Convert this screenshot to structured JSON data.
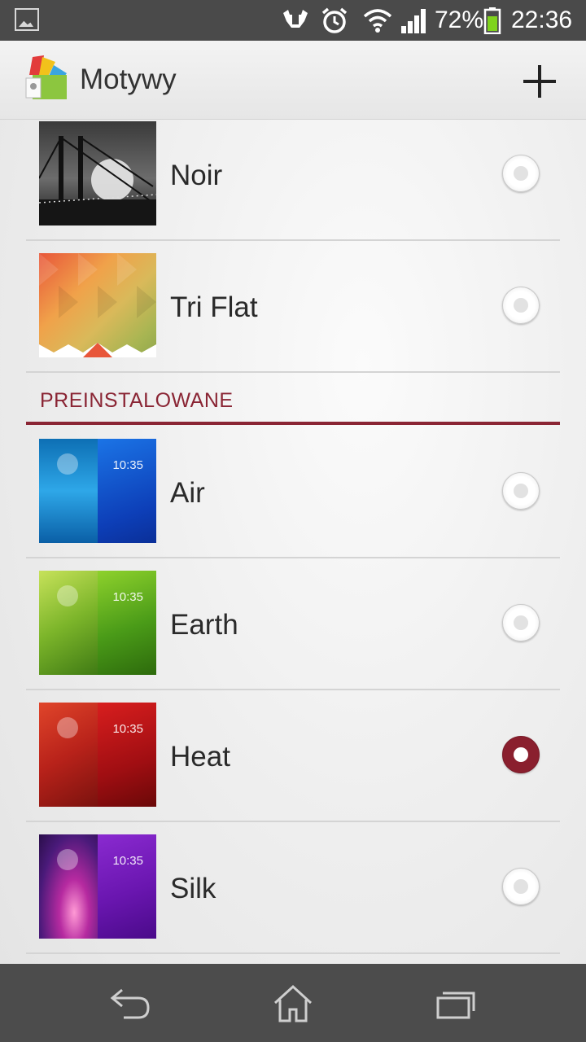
{
  "status_bar": {
    "battery_percent": "72%",
    "time": "22:36",
    "icons": [
      "gallery-icon",
      "usb-debug-icon",
      "alarm-icon",
      "wifi-icon",
      "signal-icon",
      "battery-icon"
    ]
  },
  "action_bar": {
    "title": "Motywy",
    "add_icon": "plus-icon"
  },
  "themes_downloaded": [
    {
      "name": "Noir",
      "selected": false
    },
    {
      "name": "Tri Flat",
      "selected": false
    }
  ],
  "section_preinstalled": "PREINSTALOWANE",
  "themes_preinstalled": [
    {
      "name": "Air",
      "clock": "10:35",
      "selected": false
    },
    {
      "name": "Earth",
      "clock": "10:35",
      "selected": false
    },
    {
      "name": "Heat",
      "clock": "10:35",
      "selected": true
    },
    {
      "name": "Silk",
      "clock": "10:35",
      "selected": false
    }
  ],
  "nav_bar": [
    "back-icon",
    "home-icon",
    "recents-icon"
  ],
  "colors": {
    "accent": "#8a2534",
    "status_bar": "#4a4a4a",
    "nav_bar": "#4c4c4c"
  }
}
